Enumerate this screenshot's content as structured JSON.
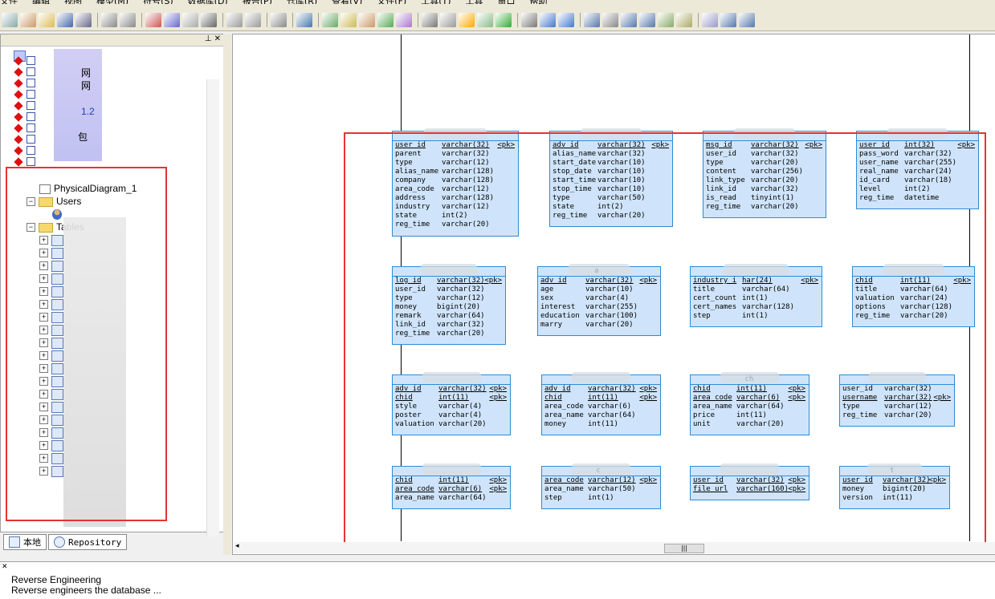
{
  "menu": [
    "文件",
    "编辑",
    "视图",
    "模型(M)",
    "符号(S)",
    "数据库(D)",
    "报告(P)",
    "仓库(R)",
    "查看(V)",
    "文件(F)",
    "工具(T)",
    "工具",
    "窗口",
    "帮助"
  ],
  "tree": {
    "diagram": "PhysicalDiagram_1",
    "users_folder": "Users",
    "tables_folder": "Tables",
    "top_fragments": [
      "网",
      "网",
      "1.2",
      "包"
    ]
  },
  "tabs": {
    "local": "本地",
    "repository": "Repository"
  },
  "output": {
    "line1": "Reverse Engineering",
    "line2": "Reverse engineers the database ..."
  },
  "entities": [
    {
      "title": "",
      "rows": [
        [
          "user_id",
          "varchar(32)",
          "<pk>"
        ],
        [
          "parent",
          "varchar(32)",
          ""
        ],
        [
          "type",
          "varchar(12)",
          ""
        ],
        [
          "alias_name",
          "varchar(128)",
          ""
        ],
        [
          "company",
          "varchar(128)",
          ""
        ],
        [
          "area_code",
          "varchar(12)",
          ""
        ],
        [
          "address",
          "varchar(128)",
          ""
        ],
        [
          "industry",
          "varchar(12)",
          ""
        ],
        [
          "state",
          "int(2)",
          ""
        ],
        [
          "reg_time",
          "varchar(20)",
          ""
        ]
      ]
    },
    {
      "title": "",
      "rows": [
        [
          "adv_id",
          "varchar(32)",
          "<pk>"
        ],
        [
          "alias_name",
          "varchar(32)",
          ""
        ],
        [
          "start_date",
          "varchar(10)",
          ""
        ],
        [
          "stop_date",
          "varchar(10)",
          ""
        ],
        [
          "start_time",
          "varchar(10)",
          ""
        ],
        [
          "stop_time",
          "varchar(10)",
          ""
        ],
        [
          "type",
          "varchar(50)",
          ""
        ],
        [
          "state",
          "int(2)",
          ""
        ],
        [
          "reg_time",
          "varchar(20)",
          ""
        ]
      ]
    },
    {
      "title": "",
      "rows": [
        [
          "msg_id",
          "varchar(32)",
          "<pk>"
        ],
        [
          "user_id",
          "varchar(32)",
          ""
        ],
        [
          "type",
          "varchar(20)",
          ""
        ],
        [
          "content",
          "varchar(256)",
          ""
        ],
        [
          "link_type",
          "varchar(20)",
          ""
        ],
        [
          "link_id",
          "varchar(32)",
          ""
        ],
        [
          "is_read",
          "tinyint(1)",
          ""
        ],
        [
          "reg_time",
          "varchar(20)",
          ""
        ]
      ]
    },
    {
      "title": "",
      "rows": [
        [
          "user_id",
          "int(32)",
          "<pk>"
        ],
        [
          "pass_word",
          "varchar(32)",
          ""
        ],
        [
          "user_name",
          "varchar(255)",
          ""
        ],
        [
          "real_name",
          "varchar(24)",
          ""
        ],
        [
          "id_card",
          "varchar(18)",
          ""
        ],
        [
          "level",
          "int(2)",
          ""
        ],
        [
          "reg_time",
          "datetime",
          ""
        ]
      ]
    },
    {
      "title": "",
      "rows": [
        [
          "log_id",
          "varchar(32)",
          "<pk>"
        ],
        [
          "user_id",
          "varchar(32)",
          ""
        ],
        [
          "type",
          "varchar(12)",
          ""
        ],
        [
          "money",
          "bigint(20)",
          ""
        ],
        [
          "remark",
          "varchar(64)",
          ""
        ],
        [
          "link_id",
          "varchar(32)",
          ""
        ],
        [
          "reg_time",
          "varchar(20)",
          ""
        ]
      ]
    },
    {
      "title": "a",
      "rows": [
        [
          "adv_id",
          "varchar(32)",
          "<pk>"
        ],
        [
          "age",
          "varchar(10)",
          ""
        ],
        [
          "sex",
          "varchar(4)",
          ""
        ],
        [
          "interest",
          "varchar(255)",
          ""
        ],
        [
          "education",
          "varchar(100)",
          ""
        ],
        [
          "marry",
          "varchar(20)",
          ""
        ]
      ]
    },
    {
      "title": "",
      "rows": [
        [
          "industry_i",
          "har(24)",
          "<pk>"
        ],
        [
          "title",
          "varchar(64)",
          ""
        ],
        [
          "cert_count",
          "int(1)",
          ""
        ],
        [
          "cert_names",
          "varchar(128)",
          ""
        ],
        [
          "step",
          "int(1)",
          ""
        ]
      ]
    },
    {
      "title": "",
      "rows": [
        [
          "chid",
          "int(11)",
          "<pk>"
        ],
        [
          "title",
          "varchar(64)",
          ""
        ],
        [
          "valuation",
          "varchar(24)",
          ""
        ],
        [
          "options",
          "varchar(128)",
          ""
        ],
        [
          "reg_time",
          "varchar(20)",
          ""
        ]
      ]
    },
    {
      "title": "",
      "rows": [
        [
          "adv_id",
          "varchar(32)",
          "<pk>"
        ],
        [
          "chid",
          "int(11)",
          "<pk>"
        ],
        [
          "style",
          "varchar(4)",
          ""
        ],
        [
          "poster",
          "varchar(4)",
          ""
        ],
        [
          "valuation",
          "varchar(20)",
          ""
        ]
      ]
    },
    {
      "title": "",
      "rows": [
        [
          "adv_id",
          "varchar(32)",
          "<pk>"
        ],
        [
          "chid",
          "int(11)",
          "<pk>"
        ],
        [
          "area_code",
          "varchar(6)",
          ""
        ],
        [
          "area_name",
          "varchar(64)",
          ""
        ],
        [
          "money",
          "int(11)",
          ""
        ]
      ]
    },
    {
      "title": "ch",
      "rows": [
        [
          "chid",
          "int(11)",
          "<pk>"
        ],
        [
          "area_code",
          "varchar(6)",
          "<pk>"
        ],
        [
          "area_name",
          "varchar(64)",
          ""
        ],
        [
          "price",
          "int(11)",
          ""
        ],
        [
          "unit",
          "varchar(20)",
          ""
        ]
      ]
    },
    {
      "title": "",
      "rows": [
        [
          "user_id",
          "varchar(32)",
          ""
        ],
        [
          "username",
          "varchar(32)",
          "<pk>"
        ],
        [
          "type",
          "varchar(12)",
          ""
        ],
        [
          "reg_time",
          "varchar(20)",
          ""
        ]
      ]
    },
    {
      "title": "",
      "rows": [
        [
          "chid",
          "int(11)",
          "<pk>"
        ],
        [
          "area_code",
          "varchar(6)",
          "<pk>"
        ],
        [
          "area_name",
          "varchar(64)",
          ""
        ]
      ]
    },
    {
      "title": "c",
      "rows": [
        [
          "area_code",
          "varchar(12)",
          "<pk>"
        ],
        [
          "area_name",
          "varchar(50)",
          ""
        ],
        [
          "step",
          "int(1)",
          ""
        ]
      ]
    },
    {
      "title": "",
      "rows": [
        [
          "user_id",
          "varchar(32)",
          "<pk>"
        ],
        [
          "file_url",
          "varchar(160)",
          "<pk>"
        ]
      ]
    },
    {
      "title": "t",
      "rows": [
        [
          "user_id",
          "varchar(32)",
          "<pk>"
        ],
        [
          "money",
          "bigint(20)",
          ""
        ],
        [
          "version",
          "int(11)",
          ""
        ]
      ]
    }
  ],
  "colors": {
    "highlight": "#e53333",
    "entity_fill": "#cfe4fa",
    "entity_border": "#2e8bd4"
  }
}
